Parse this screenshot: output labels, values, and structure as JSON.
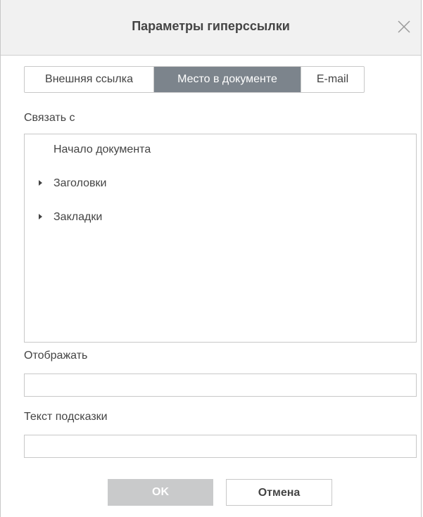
{
  "dialog": {
    "title": "Параметры гиперссылки",
    "close_icon": "close-icon"
  },
  "tabs": [
    {
      "label": "Внешняя ссылка",
      "active": false
    },
    {
      "label": "Место в документе",
      "active": true
    },
    {
      "label": "E-mail",
      "active": false
    }
  ],
  "link_to": {
    "label": "Связать с",
    "items": [
      {
        "label": "Начало документа",
        "expandable": false
      },
      {
        "label": "Заголовки",
        "expandable": true
      },
      {
        "label": "Закладки",
        "expandable": true
      }
    ]
  },
  "display": {
    "label": "Отображать",
    "value": ""
  },
  "tooltip": {
    "label": "Текст подсказки",
    "value": ""
  },
  "buttons": {
    "ok": "OK",
    "cancel": "Отмена"
  },
  "colors": {
    "active_tab": "#7c848c",
    "ok_disabled": "#c9cacb",
    "header_bg": "#f1f1f1"
  }
}
